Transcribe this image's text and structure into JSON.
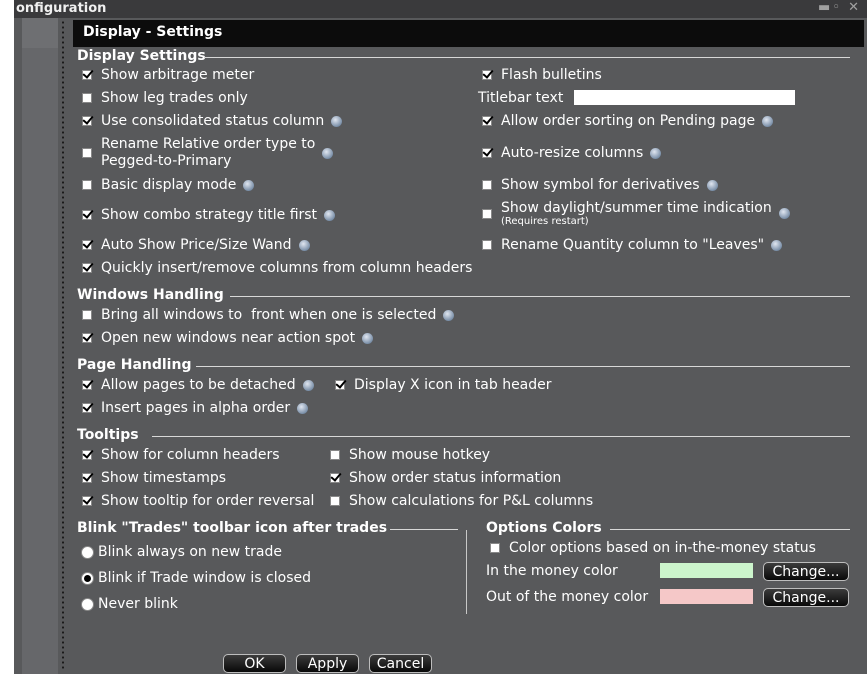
{
  "window": {
    "title": "Configuration",
    "visible_title": "onfiguration",
    "window_controls": [
      "pin-icon",
      "close-icon"
    ]
  },
  "panel": {
    "title": "Display - Settings"
  },
  "display_settings": {
    "heading": "Display Settings",
    "left": [
      {
        "label": "Show arbitrage meter",
        "checked": true,
        "info": false
      },
      {
        "label": "Show leg trades only",
        "checked": false,
        "info": false
      },
      {
        "label": "Use consolidated status column",
        "checked": true,
        "info": true
      },
      {
        "label_line1": "Rename Relative order type to",
        "label_line2": "Pegged-to-Primary",
        "checked": false,
        "info": true
      },
      {
        "label": "Basic display mode",
        "checked": false,
        "info": true
      },
      {
        "label": "Show combo strategy title first",
        "checked": true,
        "info": true
      },
      {
        "label": "Auto Show Price/Size Wand",
        "checked": true,
        "info": true
      },
      {
        "label": "Quickly insert/remove columns from column headers",
        "checked": true,
        "info": false
      }
    ],
    "right": [
      {
        "label": "Flash bulletins",
        "checked": true,
        "info": false
      },
      {
        "label": "Allow order sorting on Pending page",
        "checked": true,
        "info": true
      },
      {
        "label": "Auto-resize columns",
        "checked": true,
        "info": true
      },
      {
        "label": "Show symbol for derivatives",
        "checked": false,
        "info": true
      },
      {
        "label": "Show daylight/summer time indication",
        "note": "(Requires restart)",
        "checked": false,
        "info": true
      },
      {
        "label": "Rename Quantity column to \"Leaves\"",
        "checked": false,
        "info": true
      }
    ],
    "titlebar_text": {
      "label": "Titlebar text",
      "value": ""
    }
  },
  "windows_handling": {
    "heading": "Windows Handling",
    "items": [
      {
        "label": "Bring all windows to  front when one is selected",
        "checked": false,
        "info": true
      },
      {
        "label": "Open new windows near action spot",
        "checked": true,
        "info": true
      }
    ]
  },
  "page_handling": {
    "heading": "Page Handling",
    "items": [
      {
        "label": "Allow pages to be detached",
        "checked": true,
        "info": true
      },
      {
        "label": "Display X icon in tab header",
        "checked": true,
        "info": false
      },
      {
        "label": "Insert pages in alpha order",
        "checked": true,
        "info": true
      }
    ]
  },
  "tooltips": {
    "heading": "Tooltips",
    "items": [
      {
        "label": "Show for column headers",
        "checked": true
      },
      {
        "label": "Show mouse hotkey",
        "checked": false
      },
      {
        "label": "Show timestamps",
        "checked": true
      },
      {
        "label": "Show order status information",
        "checked": true
      },
      {
        "label": "Show tooltip for order reversal",
        "checked": true
      },
      {
        "label": "Show calculations for P&L columns",
        "checked": false
      }
    ]
  },
  "blink": {
    "heading": "Blink \"Trades\" toolbar icon after trades",
    "options": [
      {
        "label": "Blink always on new trade",
        "selected": false
      },
      {
        "label": "Blink if Trade window is closed",
        "selected": true
      },
      {
        "label": "Never blink",
        "selected": false
      }
    ]
  },
  "options_colors": {
    "heading": "Options Colors",
    "color_options": {
      "label": "Color options based on in-the-money status",
      "checked": false
    },
    "in_money": {
      "label": "In the money color",
      "color": "#ccf5cc",
      "button": "Change..."
    },
    "out_money": {
      "label": "Out of the money color",
      "color": "#f5c8c8",
      "button": "Change..."
    }
  },
  "buttons": {
    "ok": "OK",
    "apply": "Apply",
    "cancel": "Cancel"
  }
}
